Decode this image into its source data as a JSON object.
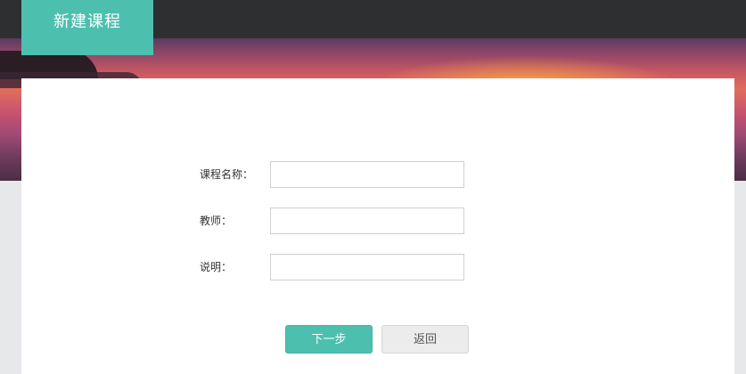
{
  "header": {
    "tab_title": "新建课程"
  },
  "form": {
    "fields": [
      {
        "label": "课程名称：",
        "value": "",
        "placeholder": ""
      },
      {
        "label": "教师：",
        "value": "",
        "placeholder": ""
      },
      {
        "label": "说明：",
        "value": "",
        "placeholder": ""
      }
    ]
  },
  "actions": {
    "next_label": "下一步",
    "back_label": "返回"
  },
  "colors": {
    "accent": "#4dbfaf",
    "topbar": "#2d2f31",
    "background": "#e7e8ea",
    "panel": "#ffffff"
  }
}
